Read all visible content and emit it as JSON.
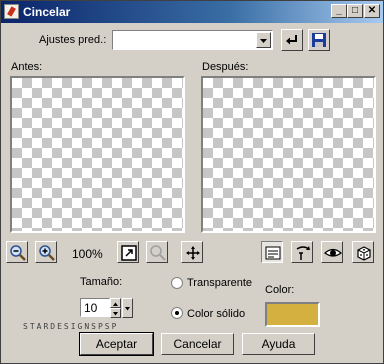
{
  "window": {
    "title": "Cincelar"
  },
  "presets": {
    "label": "Ajustes pred.:",
    "value": ""
  },
  "before": {
    "label": "Antes:"
  },
  "after": {
    "label": "Después:"
  },
  "zoom": {
    "level": "100%"
  },
  "tamano": {
    "label": "Tamaño:",
    "value": "10"
  },
  "options": {
    "transparent_label": "Transparente",
    "solid_label": "Color sólido",
    "selected": "solid"
  },
  "color": {
    "label": "Color:",
    "swatch": "#d4b040"
  },
  "watermark": "STARDESIGNSPSP",
  "buttons": {
    "ok": "Aceptar",
    "cancel": "Cancelar",
    "help": "Ayuda"
  },
  "icons": [
    "app-icon",
    "minimize-icon",
    "maximize-icon",
    "close-icon",
    "dropdown-arrow-icon",
    "reset-arrow-icon",
    "save-preset-icon",
    "zoom-out-icon",
    "zoom-in-icon",
    "zoom-fit-icon",
    "zoom-actual-icon",
    "move-icon",
    "proof-icon",
    "randomize-icon",
    "eye-icon",
    "dice-icon",
    "spin-up-icon",
    "spin-down-icon"
  ]
}
